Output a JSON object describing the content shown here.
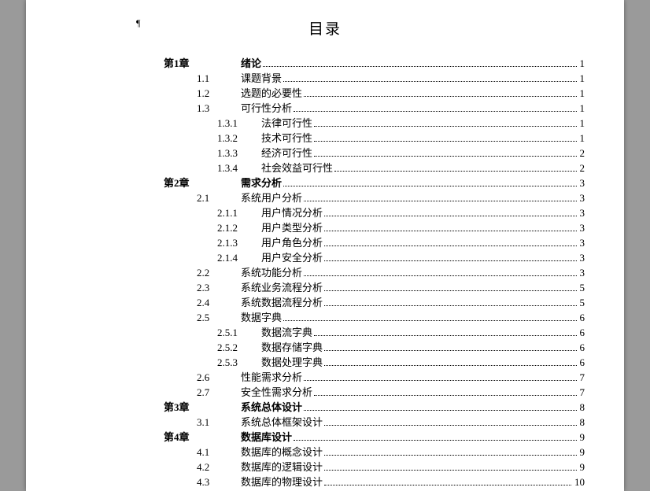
{
  "title": "目录",
  "entries": [
    {
      "level": 0,
      "num": "第1章",
      "text": "绪论",
      "page": "1"
    },
    {
      "level": 1,
      "num": "1.1",
      "text": "课题背景",
      "page": "1"
    },
    {
      "level": 1,
      "num": "1.2",
      "text": "选题的必要性",
      "page": "1"
    },
    {
      "level": 1,
      "num": "1.3",
      "text": "可行性分析",
      "page": "1"
    },
    {
      "level": 2,
      "num": "1.3.1",
      "text": "法律可行性",
      "page": "1"
    },
    {
      "level": 2,
      "num": "1.3.2",
      "text": "技术可行性",
      "page": "1"
    },
    {
      "level": 2,
      "num": "1.3.3",
      "text": "经济可行性",
      "page": "2"
    },
    {
      "level": 2,
      "num": "1.3.4",
      "text": "社会效益可行性",
      "page": "2"
    },
    {
      "level": 0,
      "num": "第2章",
      "text": "需求分析",
      "page": "3"
    },
    {
      "level": 1,
      "num": "2.1",
      "text": "系统用户分析",
      "page": "3"
    },
    {
      "level": 2,
      "num": "2.1.1",
      "text": "用户情况分析",
      "page": "3"
    },
    {
      "level": 2,
      "num": "2.1.2",
      "text": "用户类型分析",
      "page": "3"
    },
    {
      "level": 2,
      "num": "2.1.3",
      "text": "用户角色分析",
      "page": "3"
    },
    {
      "level": 2,
      "num": "2.1.4",
      "text": "用户安全分析",
      "page": "3"
    },
    {
      "level": 1,
      "num": "2.2",
      "text": "系统功能分析",
      "page": "3"
    },
    {
      "level": 1,
      "num": "2.3",
      "text": "系统业务流程分析",
      "page": "5"
    },
    {
      "level": 1,
      "num": "2.4",
      "text": "系统数据流程分析",
      "page": "5"
    },
    {
      "level": 1,
      "num": "2.5",
      "text": "数据字典",
      "page": "6"
    },
    {
      "level": 2,
      "num": "2.5.1",
      "text": "数据流字典",
      "page": "6"
    },
    {
      "level": 2,
      "num": "2.5.2",
      "text": "数据存储字典",
      "page": "6"
    },
    {
      "level": 2,
      "num": "2.5.3",
      "text": "数据处理字典",
      "page": "6"
    },
    {
      "level": 1,
      "num": "2.6",
      "text": "性能需求分析",
      "page": "7"
    },
    {
      "level": 1,
      "num": "2.7",
      "text": "安全性需求分析",
      "page": "7"
    },
    {
      "level": 0,
      "num": "第3章",
      "text": "系统总体设计",
      "page": "8"
    },
    {
      "level": 1,
      "num": "3.1",
      "text": "系统总体框架设计",
      "page": "8"
    },
    {
      "level": 0,
      "num": "第4章",
      "text": "数据库设计",
      "page": "9"
    },
    {
      "level": 1,
      "num": "4.1",
      "text": "数据库的概念设计",
      "page": "9"
    },
    {
      "level": 1,
      "num": "4.2",
      "text": "数据库的逻辑设计",
      "page": "9"
    },
    {
      "level": 1,
      "num": "4.3",
      "text": "数据库的物理设计",
      "page": "10"
    }
  ]
}
